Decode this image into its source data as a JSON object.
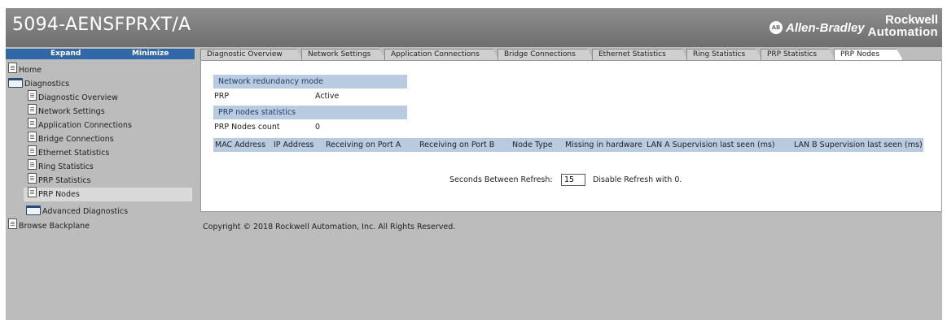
{
  "header": {
    "title": "5094-AENSFPRXT/A",
    "ab_logo": "AB",
    "ab_brand": "Allen-Bradley",
    "ra_brand_line1": "Rockwell",
    "ra_brand_line2": "Automation"
  },
  "sidebar": {
    "expand_label": "Expand",
    "minimize_label": "Minimize",
    "items": [
      {
        "label": "Home",
        "icon": "document-icon"
      },
      {
        "label": "Diagnostics",
        "icon": "folder-open-icon"
      },
      {
        "label": "Diagnostic Overview",
        "icon": "document-icon"
      },
      {
        "label": "Network Settings",
        "icon": "document-icon"
      },
      {
        "label": "Application Connections",
        "icon": "document-icon"
      },
      {
        "label": "Bridge Connections",
        "icon": "document-icon"
      },
      {
        "label": "Ethernet Statistics",
        "icon": "document-icon"
      },
      {
        "label": "Ring Statistics",
        "icon": "document-icon"
      },
      {
        "label": "PRP Statistics",
        "icon": "document-icon"
      },
      {
        "label": "PRP Nodes",
        "icon": "document-icon",
        "selected": true
      },
      {
        "label": "Advanced Diagnostics",
        "icon": "folder-icon"
      },
      {
        "label": "Browse Backplane",
        "icon": "document-icon"
      }
    ]
  },
  "tabs": [
    {
      "label": "Diagnostic Overview"
    },
    {
      "label": "Network Settings"
    },
    {
      "label": "Application Connections"
    },
    {
      "label": "Bridge Connections"
    },
    {
      "label": "Ethernet Statistics"
    },
    {
      "label": "Ring Statistics"
    },
    {
      "label": "PRP Statistics"
    },
    {
      "label": "PRP Nodes",
      "active": true
    }
  ],
  "panel": {
    "redundancy_header": "Network redundancy mode",
    "mode_label": "PRP",
    "mode_value": "Active",
    "stats_header": "PRP nodes statistics",
    "count_label": "PRP Nodes count",
    "count_value": "0",
    "columns": [
      "MAC Address",
      "IP Address",
      "Receiving on Port A",
      "Receiving on Port B",
      "Node Type",
      "Missing in hardware",
      "LAN A Supervision last seen (ms)",
      "LAN B Supervision last seen (ms)"
    ],
    "refresh_label": "Seconds Between Refresh:",
    "refresh_value": "15",
    "refresh_hint": "Disable Refresh with 0."
  },
  "footer": {
    "copyright": "Copyright © 2018 Rockwell Automation, Inc. All Rights Reserved."
  },
  "colors": {
    "header_bg": "#7a7a7a",
    "sidebar_bar": "#2f67a8",
    "band": "#b9cbe0",
    "page_bg": "#bcbcbc"
  }
}
